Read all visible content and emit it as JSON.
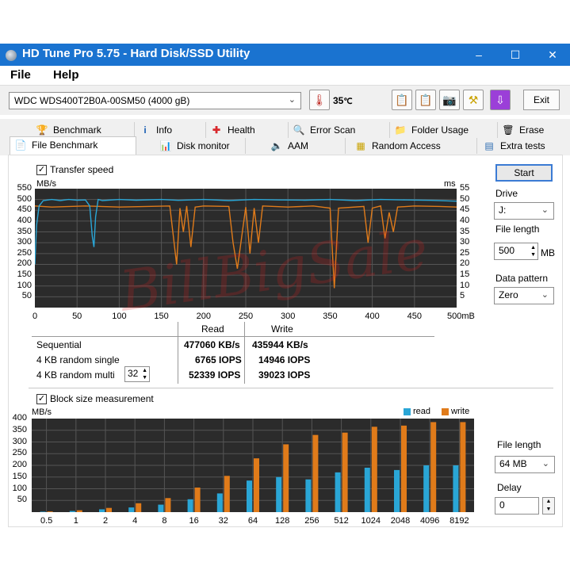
{
  "window": {
    "title": "HD Tune Pro 5.75 - Hard Disk/SSD Utility",
    "controls": [
      "–",
      "☐",
      "✕"
    ]
  },
  "menu": [
    "File",
    "Help"
  ],
  "toolbar": {
    "drive": "WDC  WDS400T2B0A-00SM50 (4000 gB)",
    "temperature": "35",
    "exit_label": "Exit"
  },
  "tabs": {
    "row1": [
      {
        "label": "Benchmark",
        "icon": "trophy-icon"
      },
      {
        "label": "Info",
        "icon": "info-icon"
      },
      {
        "label": "Health",
        "icon": "health-cross-icon"
      },
      {
        "label": "Error Scan",
        "icon": "magnifier-icon"
      },
      {
        "label": "Folder Usage",
        "icon": "folder-icon"
      },
      {
        "label": "Erase",
        "icon": "trash-icon"
      }
    ],
    "row2": [
      {
        "label": "File Benchmark",
        "icon": "file-trophy-icon"
      },
      {
        "label": "Disk monitor",
        "icon": "monitor-chart-icon"
      },
      {
        "label": "AAM",
        "icon": "speaker-icon"
      },
      {
        "label": "Random Access",
        "icon": "scatter-icon"
      },
      {
        "label": "Extra tests",
        "icon": "bars-icon"
      }
    ]
  },
  "transfer": {
    "checkbox_label": "Transfer speed",
    "left_unit": "MB/s",
    "right_unit": "ms",
    "left_ticks": [
      "550",
      "500",
      "450",
      "400",
      "350",
      "300",
      "250",
      "200",
      "150",
      "100",
      "50"
    ],
    "right_ticks": [
      "55",
      "50",
      "45",
      "40",
      "35",
      "30",
      "25",
      "20",
      "15",
      "10",
      "5"
    ],
    "x_ticks": [
      "0",
      "50",
      "100",
      "150",
      "200",
      "250",
      "300",
      "350",
      "400",
      "450",
      "500mB"
    ]
  },
  "results": {
    "col_read": "Read",
    "col_write": "Write",
    "rows": [
      {
        "label": "Sequential",
        "read": "477060 KB/s",
        "write": "435944 KB/s"
      },
      {
        "label": "4 KB random single",
        "read": "6765 IOPS",
        "write": "14946 IOPS"
      },
      {
        "label": "4 KB random multi",
        "read": "52339 IOPS",
        "write": "39023 IOPS"
      }
    ],
    "queue_depth": "32"
  },
  "right_panel": {
    "start_label": "Start",
    "drive_label": "Drive",
    "drive_value": "J:",
    "file_length_label": "File length",
    "file_length_value": "500",
    "file_length_unit": "MB",
    "data_pattern_label": "Data pattern",
    "data_pattern_value": "Zero"
  },
  "block": {
    "checkbox_label": "Block size measurement",
    "file_length_label": "File length",
    "file_length_value": "64 MB",
    "delay_label": "Delay",
    "delay_value": "0"
  },
  "colors": {
    "read": "#2aa6d6",
    "write": "#e07b1a",
    "chart_bg": "#2b2b2b",
    "titlebar": "#1a73d0"
  },
  "chart_data": [
    {
      "type": "line",
      "title": "",
      "xlabel": "",
      "ylabel": "MB/s",
      "ylabel_right": "ms",
      "xlim": [
        0,
        500
      ],
      "ylim": [
        0,
        550
      ],
      "x_unit": "mB",
      "series": [
        {
          "name": "",
          "color": "#2aa6d6",
          "x": [
            0,
            2,
            5,
            10,
            20,
            30,
            40,
            50,
            60,
            65,
            68,
            70,
            72,
            75,
            80,
            100,
            120,
            150,
            170,
            200,
            230,
            260,
            290,
            320,
            350,
            380,
            410,
            440,
            470,
            500
          ],
          "y": [
            200,
            380,
            470,
            495,
            500,
            495,
            500,
            497,
            498,
            470,
            330,
            280,
            420,
            500,
            495,
            500,
            497,
            500,
            496,
            500,
            495,
            500,
            498,
            497,
            500,
            495,
            500,
            498,
            496,
            492
          ]
        },
        {
          "name": "",
          "color": "#e07b1a",
          "x": [
            0,
            20,
            60,
            100,
            160,
            165,
            168,
            172,
            176,
            180,
            185,
            190,
            200,
            230,
            235,
            240,
            250,
            255,
            260,
            265,
            270,
            300,
            330,
            340,
            350,
            355,
            360,
            390,
            395,
            400,
            410,
            415,
            420,
            425,
            430,
            450,
            480,
            500
          ],
          "y": [
            470,
            465,
            470,
            465,
            470,
            300,
            200,
            460,
            350,
            470,
            280,
            465,
            470,
            468,
            300,
            180,
            465,
            250,
            460,
            300,
            470,
            465,
            470,
            465,
            460,
            90,
            460,
            468,
            300,
            460,
            470,
            320,
            440,
            350,
            465,
            470,
            468,
            465
          ]
        }
      ]
    },
    {
      "type": "bar",
      "title": "",
      "xlabel": "",
      "ylabel": "MB/s",
      "ylim": [
        0,
        400
      ],
      "categories": [
        "0.5",
        "1",
        "2",
        "4",
        "8",
        "16",
        "32",
        "64",
        "128",
        "256",
        "512",
        "1024",
        "2048",
        "4096",
        "8192"
      ],
      "series": [
        {
          "name": "read",
          "color": "#2aa6d6",
          "values": [
            2,
            5,
            12,
            20,
            32,
            55,
            80,
            135,
            150,
            140,
            170,
            190,
            180,
            200,
            200
          ]
        },
        {
          "name": "write",
          "color": "#e07b1a",
          "values": [
            3,
            8,
            18,
            38,
            60,
            105,
            155,
            230,
            290,
            330,
            340,
            365,
            370,
            385,
            385
          ]
        }
      ],
      "y_ticks": [
        "400",
        "350",
        "300",
        "250",
        "200",
        "150",
        "100",
        "50"
      ]
    }
  ]
}
